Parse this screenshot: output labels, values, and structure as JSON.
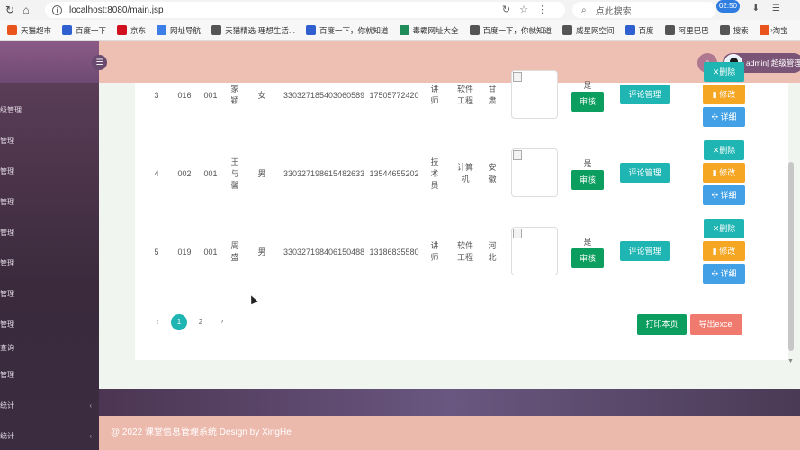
{
  "browser": {
    "url": "localhost:8080/main.jsp",
    "search_placeholder": "点此搜索",
    "clock": "02:50",
    "bookmarks": [
      {
        "label": "天猫超市",
        "color": "#e8541c"
      },
      {
        "label": "百度一下",
        "color": "#3060d0"
      },
      {
        "label": "京东",
        "color": "#d0101c"
      },
      {
        "label": "网址导航",
        "color": "#3d7ee8"
      },
      {
        "label": "天猫精选-理想生活...",
        "color": "#555555"
      },
      {
        "label": "百度一下，你就知道",
        "color": "#3060d0"
      },
      {
        "label": "毒霸网址大全",
        "color": "#1f8c5a"
      },
      {
        "label": "百度一下，你就知道",
        "color": "#555555"
      },
      {
        "label": "威星网空间",
        "color": "#555555"
      },
      {
        "label": "百度",
        "color": "#3060d0"
      },
      {
        "label": "阿里巴巴",
        "color": "#555555"
      },
      {
        "label": "搜索",
        "color": "#555555"
      },
      {
        "label": "淘宝",
        "color": "#e8541c"
      }
    ],
    "bookmarks_more": "›"
  },
  "header": {
    "user_label": "admin[ 超级管理"
  },
  "sidebar": {
    "items": [
      {
        "label": "级管理"
      },
      {
        "label": "管理"
      },
      {
        "label": "管理"
      },
      {
        "label": "管理"
      },
      {
        "label": "管理"
      },
      {
        "label": "管理"
      },
      {
        "label": "管理"
      },
      {
        "label": "管理"
      },
      {
        "label": "查询"
      },
      {
        "label": "管理"
      },
      {
        "label": "统计",
        "arrow": "‹"
      },
      {
        "label": "统计",
        "arrow": "‹"
      }
    ]
  },
  "table": {
    "rows": [
      {
        "no": "3",
        "code1": "016",
        "code2": "001",
        "name": "家\n颖",
        "gender": "女",
        "id_card": "330327185403060589",
        "phone": "17505772420",
        "title": "讲\n师",
        "dept": "软件\n工程",
        "origin": "甘\n肃",
        "status": "是",
        "review": "审核",
        "comment": "评论管理",
        "delete": "✕删除",
        "edit": "▮ 修改",
        "detail": "✣ 详细"
      },
      {
        "no": "4",
        "code1": "002",
        "code2": "001",
        "name": "王\n与\n馨",
        "gender": "男",
        "id_card": "330327198615482633",
        "phone": "13544655202",
        "title": "技\n术\n员",
        "dept": "计算\n机",
        "origin": "安\n徽",
        "status": "是",
        "review": "审核",
        "comment": "评论管理",
        "delete": "✕删除",
        "edit": "▮ 修改",
        "detail": "✣ 详细"
      },
      {
        "no": "5",
        "code1": "019",
        "code2": "001",
        "name": "周\n盛",
        "gender": "男",
        "id_card": "330327198406150488",
        "phone": "13186835580",
        "title": "讲\n师",
        "dept": "软件\n工程",
        "origin": "河\n北",
        "status": "是",
        "review": "审核",
        "comment": "评论管理",
        "delete": "✕删除",
        "edit": "▮ 修改",
        "detail": "✣ 详细"
      }
    ]
  },
  "pagination": {
    "prev": "‹",
    "pages": [
      "1",
      "2"
    ],
    "current": "1",
    "next": "›"
  },
  "actions": {
    "print": "打印本页",
    "export": "导出excel"
  },
  "footer": {
    "text": "@ 2022 课堂信息管理系统 Design by XingHe"
  },
  "colors": {
    "header_bg": "#eec0b3",
    "sidebar_bg": "#3a2a3c",
    "accent_teal": "#1fb5b2",
    "green": "#0b9e5f",
    "orange": "#f5a623",
    "blue": "#41a0e6",
    "coral": "#f07a6e"
  }
}
